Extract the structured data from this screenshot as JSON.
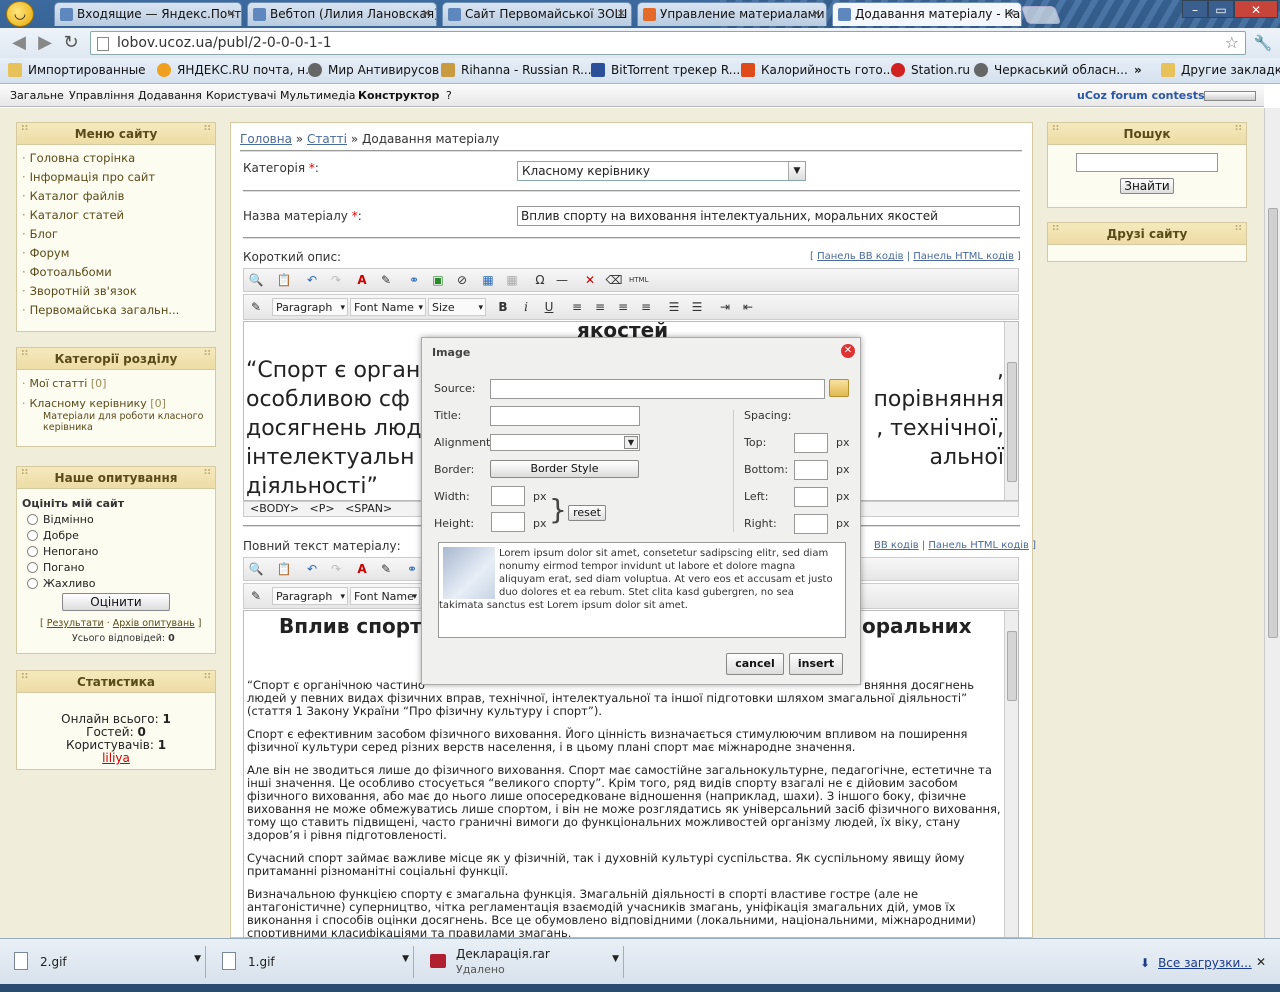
{
  "browser": {
    "tabs": [
      {
        "title": "Входящие — Яндекс.Почта"
      },
      {
        "title": "Вебтоп (Лилия Лановская)"
      },
      {
        "title": "Сайт Первомайської ЗОШ"
      },
      {
        "title": "Управление материалами"
      },
      {
        "title": "Додавання матеріалу - Кат"
      }
    ],
    "url": "lobov.ucoz.ua/publ/2-0-0-0-1-1",
    "bookmarks": [
      "Импортированные",
      "ЯНДЕКС.RU почта, н...",
      "Мир Антивирусов",
      "Rihanna - Russian R...",
      "BitTorrent трекер R...",
      "Калорийность гото...",
      "Station.ru",
      "Черкаський обласн..."
    ],
    "bookmarks_more": "»",
    "other_bookmarks": "Другие закладки"
  },
  "ucoz": {
    "menu": [
      "Загальне",
      "Управління",
      "Додавання",
      "Користувачі",
      "Мультимедіа",
      "Конструктор",
      "?"
    ],
    "contests": "uCoz forum contests"
  },
  "site_menu": {
    "title": "Меню сайту",
    "items": [
      "Головна сторінка",
      "Інформація про сайт",
      "Каталог файлів",
      "Каталог статей",
      "Блог",
      "Форум",
      "Фотоальбоми",
      "Зворотній зв'язок",
      "Первомайська загальн..."
    ]
  },
  "categories": {
    "title": "Категорії розділу",
    "items": [
      {
        "label": "Мої статті",
        "count": "[0]"
      },
      {
        "label": "Класному керівнику",
        "count": "[0]",
        "desc": "Матеріали для роботи класного керівника"
      }
    ]
  },
  "poll": {
    "title": "Наше опитування",
    "question": "Оцініть мій сайт",
    "options": [
      "Відмінно",
      "Добре",
      "Непогано",
      "Погано",
      "Жахливо"
    ],
    "vote_button": "Оцінити",
    "results_link": "Результати",
    "archive_link": "Архів опитувань",
    "total": "Усього відповідей:",
    "total_count": "0"
  },
  "stats": {
    "title": "Статистика",
    "online_label": "Онлайн всього:",
    "online": "1",
    "guests_label": "Гостей:",
    "guests": "0",
    "users_label": "Користувачів:",
    "users": "1",
    "user": "liliya"
  },
  "search": {
    "title": "Пошук",
    "button": "Знайти"
  },
  "friends": {
    "title": "Друзі сайту"
  },
  "form": {
    "breadcrumb_home": "Головна",
    "breadcrumb_sep": "»",
    "breadcrumb_articles": "Статті",
    "breadcrumb_current": "» Додавання матеріалу",
    "category_label": "Категорія",
    "category_value": "Класному керівнику",
    "name_label": "Назва матеріалу",
    "name_value": "Вплив спорту на виховання інтелектуальних, моральних якостей",
    "required": "*",
    "colon": ":",
    "short_label": "Короткий опис:",
    "full_label": "Повний текст матеріалу:",
    "panel_bb": "Панель BB кодів",
    "panel_bb_cut": "BB кодів",
    "panel_html": "Панель HTML кодів",
    "para_dd": "Paragraph",
    "font_dd": "Font Name",
    "size_dd": "Size",
    "path": "<BODY>   <P>   <SPAN>",
    "short_heading": "якостей",
    "short_lines": [
      "“Спорт є орган",
      "особливою сф",
      "досягнень люд",
      "інтелектуальн",
      "діяльності”"
    ],
    "short_right": [
      ",",
      "порівняння",
      ", технічної,",
      "альної"
    ],
    "full_heading_left": "Вплив спорт",
    "full_heading_right": "оральних",
    "full_p1_left": "“Спорт є органічною частино",
    "full_p1_right": "вняння досягнень",
    "full_p1_rest": "людей у певних видах фізичних вправ, технічної, інтелектуальної та іншої підготовки шляхом змагальної діяльності” (стаття 1 Закону України “Про фізичну культуру і спорт”).",
    "full_p2": "Спорт є ефективним засобом фізичного виховання. Його цінність визначається стимулюючим впливом на поширення фізичної культури серед різних верств населення, і в цьому плані спорт має міжнародне значення.",
    "full_p3": "Але він не зводиться лише до фізичного виховання. Спорт має самостійне загальнокультурне, педагогічне, естетичне та інші значення. Це особливо стосується “великого спорту”. Крім того, ряд видів спорту взагалі не є дійовим засобом фізичного виховання, або має до нього лише опосередковане відношення (наприклад, шахи). З іншого боку, фізичне виховання не може обмежуватись лише спортом, і він не може розглядатись як універсальний засіб фізичного виховання, тому що ставить підвищені, часто граничні вимоги до функціональних можливостей організму людей, їх віку, стану здоров’я і рівня підготовленості.",
    "full_p4": "Сучасний спорт займає важливе місце як у фізичній, так і духовній культурі суспільства. Як суспільному явищу йому притаманні різноманітні соціальні функції.",
    "full_p5": "Визначальною функцією спорту є змагальна функція. Змагальній діяльності в спорті властиве гостре (але не антагоністичне) суперництво, чітка регламентація взаємодій учасників змагань, уніфікація змагальних дій, умов їх виконання і способів оцінки досягнень. Все це обумовлено відповідними (локальними, національними, міжнародними) спортивними класифікаціями та правилами змагань."
  },
  "dialog": {
    "title": "Image",
    "source": "Source:",
    "title_label": "Title:",
    "alignment": "Alignment:",
    "border": "Border:",
    "border_btn": "Border Style",
    "width": "Width:",
    "height": "Height:",
    "reset": "reset",
    "spacing": "Spacing:",
    "top": "Top:",
    "bottom": "Bottom:",
    "left": "Left:",
    "right": "Right:",
    "px": "px",
    "preview_text": "Lorem ipsum dolor sit amet, consetetur sadipscing elitr, sed diam nonumy eirmod tempor invidunt ut labore et dolore magna aliquyam erat, sed diam voluptua. At vero eos et accusam et justo duo dolores et ea rebum. Stet clita kasd gubergren, no sea takimata sanctus est Lorem ipsum dolor sit amet.",
    "cancel": "cancel",
    "insert": "insert"
  },
  "downloads": {
    "items": [
      {
        "name": "2.gif"
      },
      {
        "name": "1.gif"
      },
      {
        "name": "Декларація.rar",
        "status": "Удалено"
      }
    ],
    "all": "Все загрузки..."
  },
  "colors": {
    "accent": "#4a6a9a",
    "panel_bg": "#f0eedb",
    "header_bg": "#eddca5",
    "required": "#dd0000"
  }
}
